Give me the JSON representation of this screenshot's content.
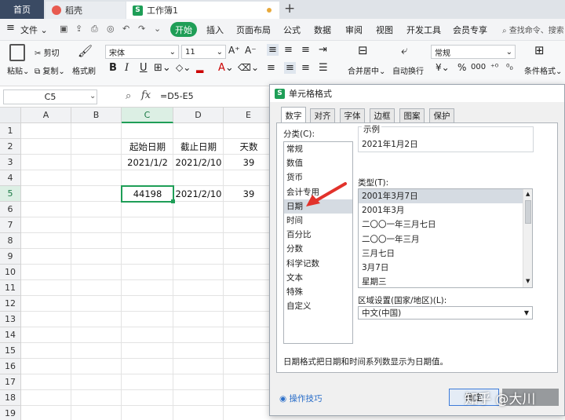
{
  "tabs": {
    "home": "首页",
    "docer": "稻壳",
    "workbook": "工作簿1",
    "workbook_icon": "S",
    "new_tab": "+"
  },
  "menu": {
    "file": "文件",
    "start": "开始",
    "items": [
      "插入",
      "页面布局",
      "公式",
      "数据",
      "审阅",
      "视图",
      "开发工具",
      "会员专享"
    ],
    "search": "查找命令、搜索"
  },
  "toolbar": {
    "paste": "粘贴",
    "cut": "剪切",
    "copy": "复制",
    "format_painter": "格式刷",
    "font_name": "宋体",
    "font_size": "11",
    "merge_center": "合并居中",
    "wrap_text": "自动换行",
    "number_format": "常规",
    "conditional_format": "条件格式",
    "bold": "B",
    "italic": "I",
    "underline": "U",
    "font_color": "A",
    "currency": "¥",
    "percent": "%",
    "thousands": "000"
  },
  "formula_bar": {
    "cell_ref": "C5",
    "fx": "fx",
    "formula": "=D5-E5"
  },
  "sheet": {
    "columns": [
      "A",
      "B",
      "C",
      "D",
      "E"
    ],
    "rows": [
      "1",
      "2",
      "3",
      "4",
      "5",
      "6",
      "7",
      "8",
      "9",
      "10",
      "11",
      "12",
      "13",
      "14",
      "15",
      "16",
      "17",
      "18",
      "19"
    ],
    "headers": {
      "start": "起始日期",
      "end": "截止日期",
      "days": "天数"
    },
    "row3": {
      "start": "2021/1/2",
      "end": "2021/2/10",
      "days": "39"
    },
    "row5": {
      "start": "44198",
      "end": "2021/2/10",
      "days": "39"
    }
  },
  "dialog": {
    "title": "单元格格式",
    "icon": "S",
    "tabs": [
      "数字",
      "对齐",
      "字体",
      "边框",
      "图案",
      "保护"
    ],
    "category_label": "分类(C):",
    "categories": [
      "常规",
      "数值",
      "货币",
      "会计专用",
      "日期",
      "时间",
      "百分比",
      "分数",
      "科学记数",
      "文本",
      "特殊",
      "自定义"
    ],
    "selected_category": "日期",
    "sample_label": "示例",
    "sample_value": "2021年1月2日",
    "type_label": "类型(T):",
    "types": [
      "2001年3月7日",
      "2001年3月",
      "二〇〇一年三月七日",
      "二〇〇一年三月",
      "三月七日",
      "3月7日",
      "星期三"
    ],
    "locale_label": "区域设置(国家/地区)(L):",
    "locale_value": "中文(中国)",
    "description": "日期格式把日期和时间系列数显示为日期值。",
    "tips": "操作技巧",
    "ok": "确定"
  },
  "watermark": "知乎 @大川",
  "colors": {
    "accent": "#1f9e57",
    "tab_dark": "#3a4a63",
    "arrow": "#e2322b"
  }
}
